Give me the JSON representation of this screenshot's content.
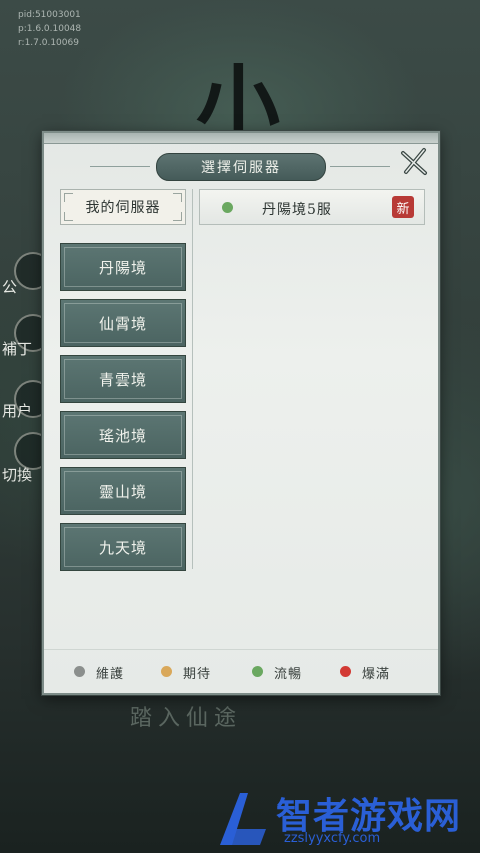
{
  "debug": {
    "lines": [
      "pid:51003001",
      "p:1.6.0.10048",
      "r:1.7.0.10069"
    ]
  },
  "background": {
    "logo_char": "小",
    "side_labels": [
      "公",
      "補丁",
      "用户",
      "切換"
    ],
    "bottom_text": "踏入仙途"
  },
  "dialog": {
    "title": "選擇伺服器",
    "my_server_label": "我的伺服器",
    "regions": [
      {
        "label": "丹陽境"
      },
      {
        "label": "仙霄境"
      },
      {
        "label": "青雲境"
      },
      {
        "label": "瑤池境"
      },
      {
        "label": "靈山境"
      },
      {
        "label": "九天境"
      }
    ],
    "servers": [
      {
        "name": "丹陽境5服",
        "status": "流暢",
        "status_color": "#6aa860",
        "badge": "新"
      }
    ],
    "legend": [
      {
        "label": "維護",
        "color": "#8b8f8d"
      },
      {
        "label": "期待",
        "color": "#d9a85a"
      },
      {
        "label": "流暢",
        "color": "#6aa860"
      },
      {
        "label": "爆滿",
        "color": "#d23a34"
      }
    ]
  },
  "watermark": {
    "title": "智者游戏网",
    "url": "zzslyyxcfy.com"
  }
}
